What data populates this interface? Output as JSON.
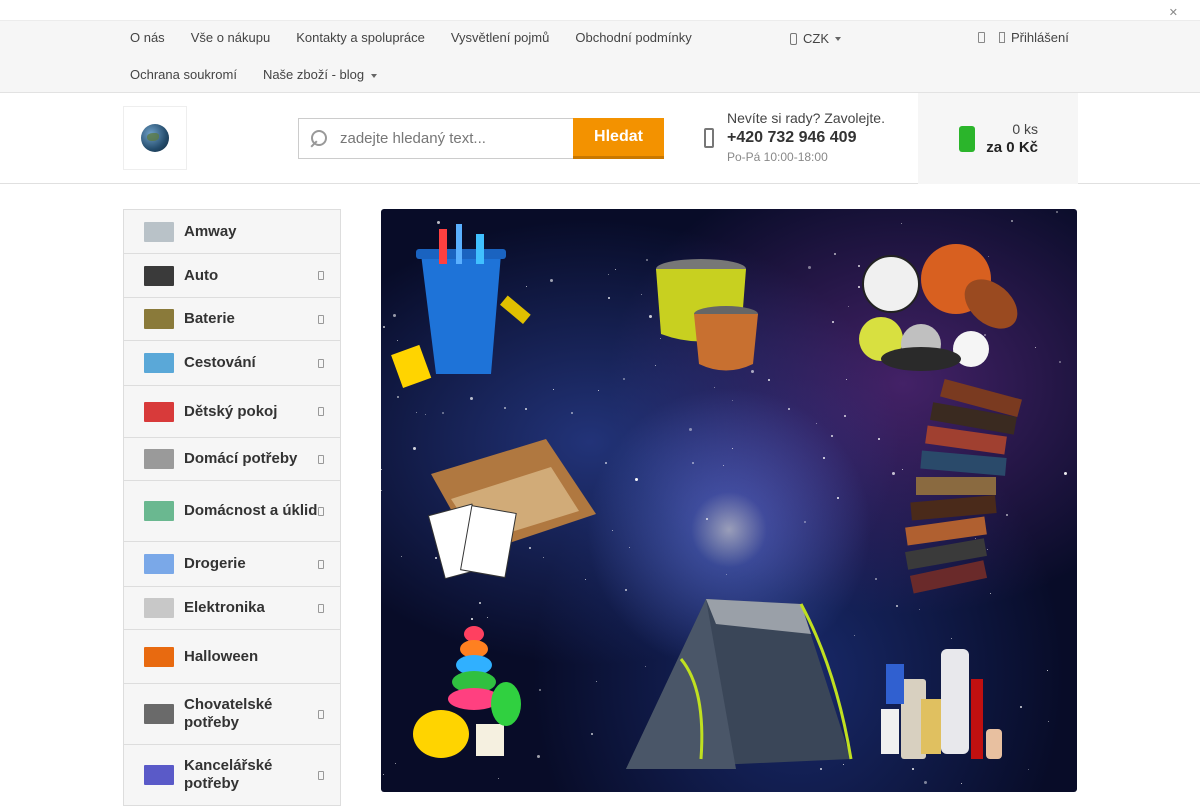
{
  "top_strip": {
    "close_icon": "close-icon"
  },
  "topnav": {
    "links_row1": [
      "O nás",
      "Vše o nákupu",
      "Kontakty a spolupráce",
      "Vysvětlení pojmů",
      "Obchodní podmínky"
    ],
    "links_row2": [
      "Ochrana soukromí",
      "Naše zboží - blog"
    ],
    "currency": "CZK",
    "login": "Přihlášení"
  },
  "header": {
    "search": {
      "placeholder": "zadejte hledaný text...",
      "button": "Hledat"
    },
    "contact": {
      "question": "Nevíte si rady? Zavolejte.",
      "phone": "+420 732 946 409",
      "hours": "Po-Pá 10:00-18:00"
    },
    "cart": {
      "count": "0 ks",
      "total": "za 0 Kč"
    }
  },
  "categories": [
    {
      "label": "Amway",
      "has_sub": false,
      "color": "#b9c2c8"
    },
    {
      "label": "Auto",
      "has_sub": true,
      "color": "#3a3a3a"
    },
    {
      "label": "Baterie",
      "has_sub": true,
      "color": "#8a7a3a"
    },
    {
      "label": "Cestování",
      "has_sub": true,
      "color": "#5aa8d8"
    },
    {
      "label": "Dětský pokoj",
      "has_sub": true,
      "color": "#d83a3a"
    },
    {
      "label": "Domácí potřeby",
      "has_sub": true,
      "color": "#9a9a9a"
    },
    {
      "label": "Domácnost a úklid",
      "has_sub": true,
      "color": "#6ab890"
    },
    {
      "label": "Drogerie",
      "has_sub": true,
      "color": "#7aa8e8"
    },
    {
      "label": "Elektronika",
      "has_sub": true,
      "color": "#c8c8c8"
    },
    {
      "label": "Halloween",
      "has_sub": false,
      "color": "#e86a10"
    },
    {
      "label": "Chovatelské potřeby",
      "has_sub": true,
      "color": "#6a6a6a"
    },
    {
      "label": "Kancelářské potřeby",
      "has_sub": true,
      "color": "#5a5ac8"
    }
  ]
}
